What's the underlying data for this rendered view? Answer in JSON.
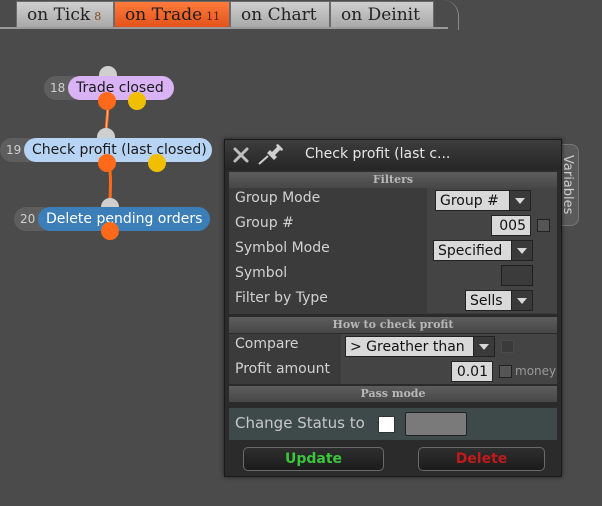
{
  "tabs": [
    {
      "label": "on Tick",
      "count": "8",
      "active": false
    },
    {
      "label": "on Trade",
      "count": "11",
      "active": true
    },
    {
      "label": "on Chart",
      "count": "",
      "active": false
    },
    {
      "label": "on Deinit",
      "count": "",
      "active": false
    }
  ],
  "nodes": [
    {
      "number": "18",
      "label": "Trade closed",
      "color": "#d9b3f5"
    },
    {
      "number": "19",
      "label": "Check profit (last closed)",
      "color": "#b8d4f5"
    },
    {
      "number": "20",
      "label": "Delete pending orders",
      "color": "#3c7fb8"
    }
  ],
  "dialog": {
    "title": "Check profit (last c...",
    "variables_tab": "Variables",
    "filters": {
      "header": "Filters",
      "group_mode_label": "Group Mode",
      "group_mode_value": "Group #",
      "group_num_label": "Group #",
      "group_num_value": "005",
      "symbol_mode_label": "Symbol Mode",
      "symbol_mode_value": "Specified",
      "symbol_label": "Symbol",
      "symbol_value": "",
      "filter_type_label": "Filter by Type",
      "filter_type_value": "Sells"
    },
    "check": {
      "header": "How to check profit",
      "compare_label": "Compare",
      "compare_value": "> Greather than",
      "profit_label": "Profit amount",
      "profit_value": "0.01",
      "money_label": "money"
    },
    "pass": {
      "header": "Pass mode",
      "change_status_label": "Change Status to"
    },
    "update_label": "Update",
    "delete_label": "Delete"
  }
}
